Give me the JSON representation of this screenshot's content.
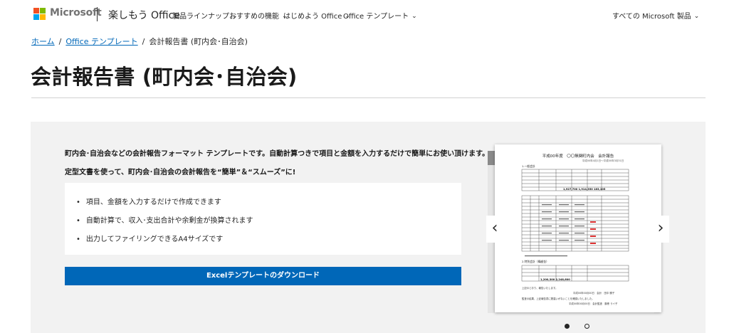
{
  "header": {
    "brand": "Microsoft",
    "site_name": "楽しもう Office",
    "nav": [
      {
        "label": "製品ラインナップ"
      },
      {
        "label": "おすすめの機能"
      },
      {
        "label": "はじめよう Office"
      },
      {
        "label": "Office テンプレート"
      }
    ],
    "all_products": "すべての Microsoft 製品"
  },
  "breadcrumb": {
    "home": "ホーム",
    "templates": "Office テンプレート",
    "current": "会計報告書 (町内会･自治会)"
  },
  "page_title": "会計報告書 (町内会･自治会)",
  "content": {
    "lead": "町内会･自治会などの会計報告フォーマット テンプレートです。自動計算つきで項目と金額を入力するだけで簡単にお使い頂けます。",
    "lead2": "定型文書を使って、町内会･自治会の会計報告を“簡単”＆“スムーズ”に!",
    "features": [
      "項目、金額を入力するだけで作成できます",
      "自動計算で、収入･支出合計や余剰金が換算されます",
      "出力してファイリングできるA4サイズです"
    ],
    "download_label": "Excelテンプレートのダウンロード"
  },
  "carousel": {
    "doc_title": "平成00年度　〇〇無関町内会　会計報告",
    "doc_subtitle": "平成00年4月1日～平成00年3月31日",
    "section1": "1.一般会計",
    "section2": "2.特別会計（繰越金）",
    "total1": "1,927,700  1,914,350  183,105",
    "total2": "1,200,300  2,248,600",
    "footer1": "上記のとおり、報告いたします。",
    "footer2": "平成00年00月00日　会計　田中 勝子",
    "footer3": "監査の結果、上記報告書に間違いがないことを確認いたしました。",
    "footer4": "平成00年00月00日　会計監査　藤巻 ライ子",
    "prev_glyph": "‹",
    "next_glyph": "›",
    "slide_count": 2,
    "active_slide": 1
  },
  "colors": {
    "accent": "#0067b8",
    "panel_bg": "#f2f2f2",
    "text": "#262626"
  },
  "icons": [
    "microsoft-logo-icon",
    "chevron-down-icon",
    "chevron-left-icon",
    "chevron-right-icon"
  ]
}
